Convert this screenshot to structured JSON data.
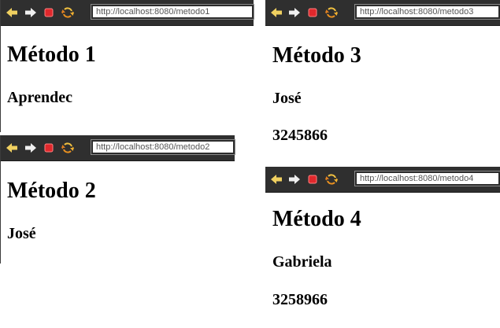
{
  "windows": [
    {
      "url": "http://localhost:8080/metodo1",
      "heading": "Método 1",
      "lines": [
        "Aprendec"
      ]
    },
    {
      "url": "http://localhost:8080/metodo2",
      "heading": "Método 2",
      "lines": [
        "José"
      ]
    },
    {
      "url": "http://localhost:8080/metodo3",
      "heading": "Método 3",
      "lines": [
        "José",
        "3245866"
      ]
    },
    {
      "url": "http://localhost:8080/metodo4",
      "heading": "Método 4",
      "lines": [
        "Gabriela",
        "3258966"
      ]
    }
  ],
  "toolbar_icons": [
    "back-arrow-icon",
    "forward-arrow-icon",
    "stop-icon",
    "reload-icon"
  ],
  "colors": {
    "toolbar_bg": "#2f2f2f",
    "arrow": "#f0d060",
    "stop": "#e0282c",
    "reload": "#e8a020"
  }
}
